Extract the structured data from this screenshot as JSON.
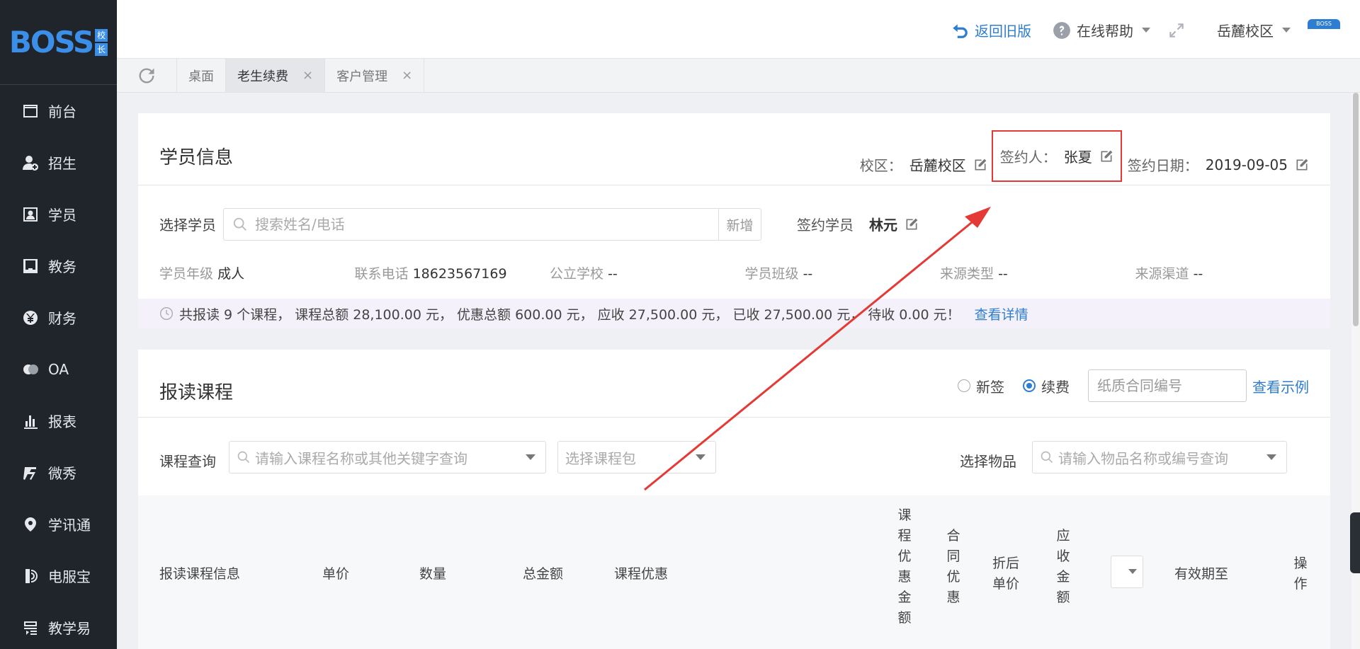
{
  "logo": {
    "text": "BOSS",
    "side_top": "校",
    "side_bottom": "长"
  },
  "sidebar": {
    "items": [
      {
        "label": "前台",
        "icon": "desk-icon"
      },
      {
        "label": "招生",
        "icon": "user-add-icon"
      },
      {
        "label": "学员",
        "icon": "student-card-icon"
      },
      {
        "label": "教务",
        "icon": "book-icon"
      },
      {
        "label": "财务",
        "icon": "yen-icon"
      },
      {
        "label": "OA",
        "icon": "oa-icon"
      },
      {
        "label": "报表",
        "icon": "bar-chart-icon"
      },
      {
        "label": "微秀",
        "icon": "weixiu-icon"
      },
      {
        "label": "学讯通",
        "icon": "location-pin-icon"
      },
      {
        "label": "电服宝",
        "icon": "phone-service-icon"
      },
      {
        "label": "教学易",
        "icon": "teach-icon"
      }
    ]
  },
  "header": {
    "back_label": "返回旧版",
    "help_label": "在线帮助",
    "campus_label": "岳麓校区",
    "badge_text": "BOSS",
    "accent_color": "#2d7dd2"
  },
  "tabs": [
    {
      "label": "桌面",
      "closable": false
    },
    {
      "label": "老生续费",
      "closable": true,
      "active": true
    },
    {
      "label": "客户管理",
      "closable": true
    }
  ],
  "student_info": {
    "title": "学员信息",
    "campus_label": "校区：",
    "campus_value": "岳麓校区",
    "signer_label": "签约人：",
    "signer_value": "张夏",
    "sign_date_label": "签约日期：",
    "sign_date_value": "2019-09-05",
    "select_label": "选择学员",
    "search_placeholder": "搜索姓名/电话",
    "add_label": "新增",
    "sign_student_label": "签约学员",
    "sign_student_value": "林元",
    "details": [
      {
        "label": "学员年级",
        "value": "成人"
      },
      {
        "label": "联系电话",
        "value": "18623567169"
      },
      {
        "label": "公立学校",
        "value": "--"
      },
      {
        "label": "学员班级",
        "value": "--"
      },
      {
        "label": "来源类型",
        "value": "--"
      },
      {
        "label": "来源渠道",
        "value": "--"
      }
    ],
    "summary_text": "共报读 9 个课程， 课程总额 28,100.00 元， 优惠总额 600.00 元， 应收 27,500.00 元， 已收 27,500.00 元， 待收 0.00 元！",
    "summary_link": "查看详情"
  },
  "courses": {
    "title": "报读课程",
    "radio_new": "新签",
    "radio_renew": "续费",
    "contract_placeholder": "纸质合同编号",
    "example_link": "查看示例",
    "query_label": "课程查询",
    "query_placeholder": "请输入课程名称或其他关键字查询",
    "package_placeholder": "选择课程包",
    "item_label": "选择物品",
    "item_placeholder": "请输入物品名称或编号查询",
    "columns": {
      "info": "报读课程信息",
      "price": "单价",
      "qty": "数量",
      "total": "总金额",
      "discount": "课程优惠",
      "discount_amount": "课程优惠金额",
      "contract_discount": "合同优惠",
      "discounted_price": "折后单价",
      "receivable": "应收金额",
      "valid_until": "有效期至",
      "ops": "操作"
    }
  },
  "annotation_color": "#e53935"
}
